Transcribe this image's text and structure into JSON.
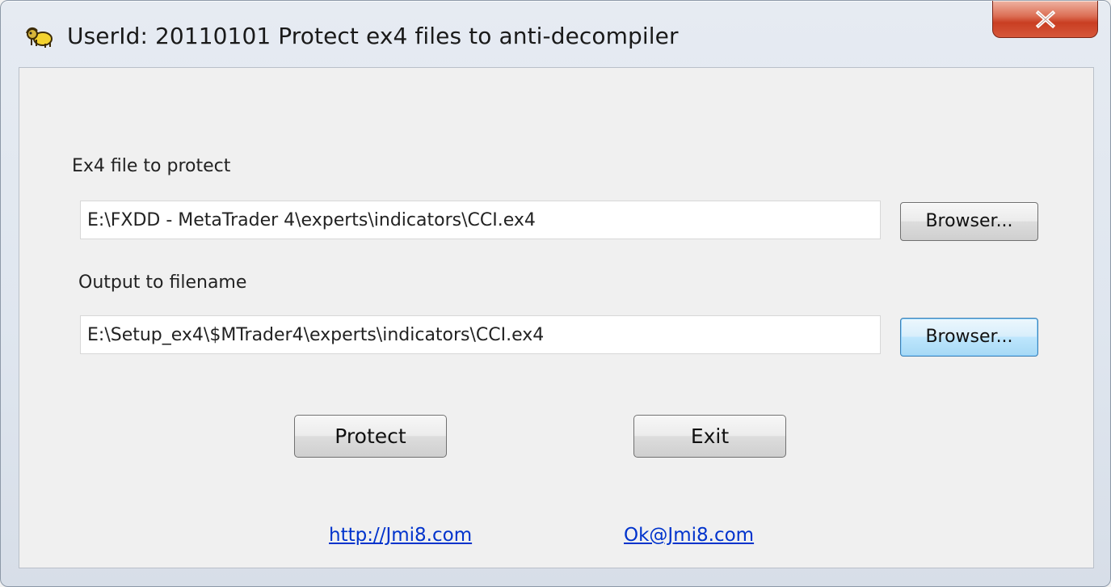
{
  "window": {
    "title": "UserId: 20110101    Protect ex4 files to anti-decompiler",
    "icon": "camel-app-icon",
    "close_label": "close-icon"
  },
  "form": {
    "input_label": "Ex4 file to protect",
    "input_path": "E:\\FXDD - MetaTrader 4\\experts\\indicators\\CCI.ex4",
    "output_label": "Output to filename",
    "output_path": "E:\\Setup_ex4\\$MTrader4\\experts\\indicators\\CCI.ex4",
    "browse_label_1": "Browser...",
    "browse_label_2": "Browser..."
  },
  "actions": {
    "protect_label": "Protect",
    "exit_label": "Exit"
  },
  "links": {
    "site": "http://Jmi8.com",
    "email": "Ok@Jmi8.com"
  },
  "colors": {
    "link": "#0033cc",
    "close_button": "#c93e22",
    "focused_button_border": "#3c7fb1"
  }
}
